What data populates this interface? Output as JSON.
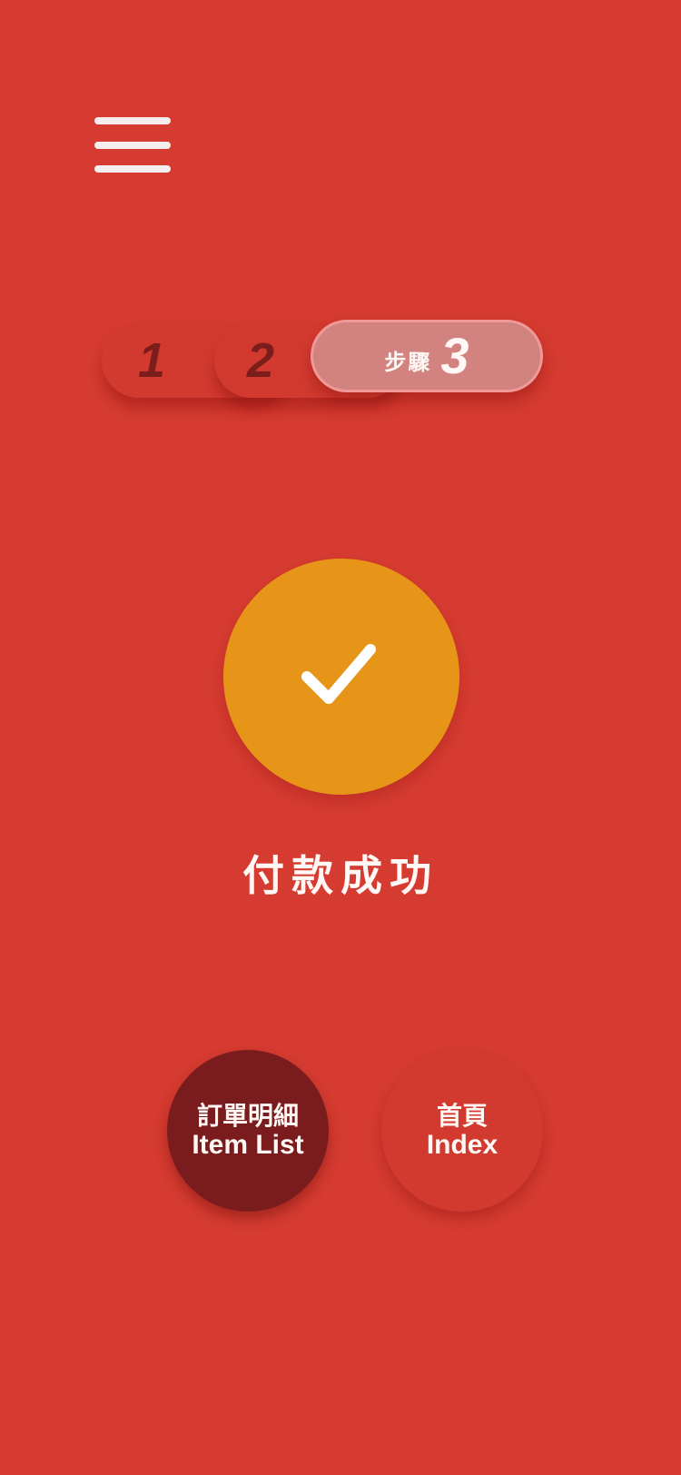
{
  "header": {
    "menu_icon": "hamburger-menu-icon"
  },
  "stepper": {
    "steps": [
      {
        "number": "1"
      },
      {
        "number": "2"
      },
      {
        "label": "步驟",
        "number": "3"
      }
    ],
    "current_step": 3
  },
  "status": {
    "icon": "checkmark-icon",
    "message": "付款成功"
  },
  "actions": {
    "item_list": {
      "label_zh": "訂單明細",
      "label_en": "Item List"
    },
    "index": {
      "label_zh": "首頁",
      "label_en": "Index"
    }
  },
  "colors": {
    "background": "#d53b30",
    "success_circle": "#e79518",
    "primary_button": "#7a1c1d",
    "text": "#fff8f5"
  }
}
